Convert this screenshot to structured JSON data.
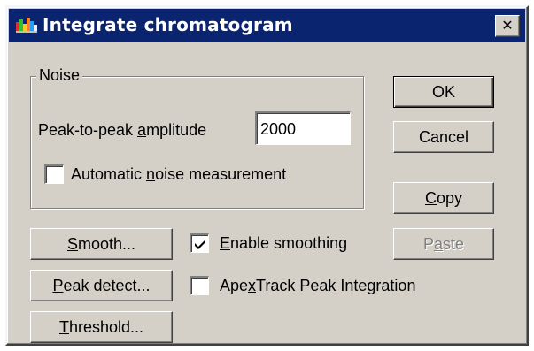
{
  "dialog": {
    "title": "Integrate chromatogram",
    "close_glyph": "✕"
  },
  "noise": {
    "group_label": "Noise",
    "amplitude_label_pre": "Peak-to-peak ",
    "amplitude_label_mn": "a",
    "amplitude_label_post": "mplitude",
    "amplitude_value": "2000",
    "auto_label_pre": "Automatic ",
    "auto_label_mn": "n",
    "auto_label_post": "oise measurement",
    "auto_checked": false
  },
  "buttons": {
    "ok": "OK",
    "cancel": "Cancel",
    "copy_mn": "C",
    "copy_post": "opy",
    "paste_pre": "P",
    "paste_mn": "a",
    "paste_post": "ste",
    "smooth_mn": "S",
    "smooth_post": "mooth...",
    "peak_mn": "P",
    "peak_post": "eak detect...",
    "threshold_mn": "T",
    "threshold_post": "hreshold..."
  },
  "options": {
    "enable_smoothing_mn": "E",
    "enable_smoothing_post": "nable smoothing",
    "enable_smoothing_checked": true,
    "apextrack_pre": "Ape",
    "apextrack_mn": "x",
    "apextrack_post": "Track Peak Integration",
    "apextrack_checked": false
  },
  "icons": {
    "app": "chromatogram-app-icon",
    "check": "checkmark-icon"
  },
  "colors": {
    "titlebar": "#0a2470",
    "face": "#d4d0c8"
  }
}
